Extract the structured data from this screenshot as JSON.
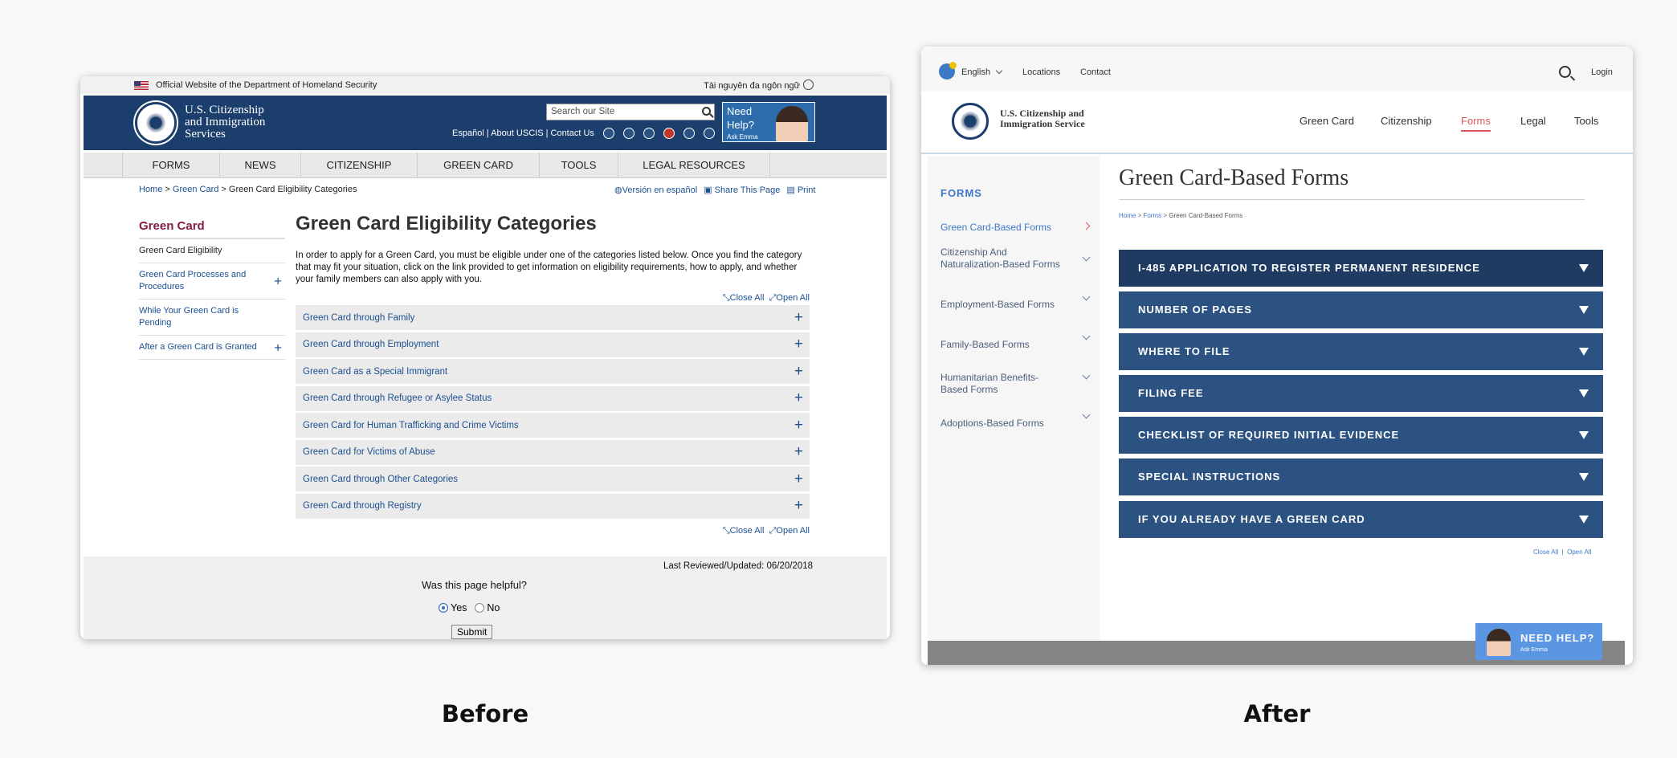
{
  "captions": {
    "before": "Before",
    "after": "After"
  },
  "before": {
    "gov_banner": "Official Website of the Department of Homeland Security",
    "language_link": "Tài nguyên đa ngôn ngữ",
    "agency_name": [
      "U.S. Citizenship",
      "and Immigration",
      "Services"
    ],
    "search_placeholder": "Search our Site",
    "header_links": "Español | About USCIS | Contact Us",
    "need_help": "Need Help?",
    "ask_emma": "Ask Emma",
    "nav": [
      "FORMS",
      "NEWS",
      "CITIZENSHIP",
      "GREEN CARD",
      "TOOLS",
      "LEGAL RESOURCES"
    ],
    "breadcrumb": {
      "home": "Home",
      "green_card": "Green Card",
      "current": "Green Card Eligibility Categories",
      "sep": " > "
    },
    "utility": {
      "spanish": "Versión en español",
      "share": "Share This Page",
      "print": "Print"
    },
    "sidebar": {
      "title": "Green Card",
      "items": [
        {
          "label": "Green Card Eligibility",
          "expand": ""
        },
        {
          "label": "Green Card Processes and Procedures",
          "expand": "+"
        },
        {
          "label": "While Your Green Card is Pending",
          "expand": ""
        },
        {
          "label": "After a Green Card is Granted",
          "expand": "+"
        }
      ]
    },
    "page_title": "Green Card Eligibility Categories",
    "intro": "In order to apply for a Green Card, you must be eligible under one of the categories listed below. Once you find the category that may fit your situation, click on the link provided to get information on eligibility requirements, how to apply, and whether your family members can also apply with you.",
    "close_all": "Close All",
    "open_all": "Open All",
    "accordion": [
      "Green Card through Family",
      "Green Card through Employment",
      "Green Card as a Special Immigrant",
      "Green Card through Refugee or Asylee Status",
      "Green Card for Human Trafficking and Crime Victims",
      "Green Card for Victims of Abuse",
      "Green Card through Other Categories",
      "Green Card through Registry"
    ],
    "expand_symbol": "+",
    "last_reviewed": "Last Reviewed/Updated: 06/20/2018",
    "helpful_question": "Was this page helpful?",
    "yes": "Yes",
    "no": "No",
    "submit": "Submit"
  },
  "after": {
    "language": "English",
    "locations": "Locations",
    "contact": "Contact",
    "login": "Login",
    "agency_name": [
      "U.S. Citizenship and",
      "Immigration Service"
    ],
    "nav": [
      "Green Card",
      "Citizenship",
      "Forms",
      "Legal",
      "Tools"
    ],
    "nav_active": "Forms",
    "sidebar_title": "FORMS",
    "sidebar": [
      "Green Card-Based Forms",
      "Citizenship And Naturalization-Based Forms",
      "Employment-Based Forms",
      "Family-Based Forms",
      "Humanitarian Benefits-Based Forms",
      "Adoptions-Based Forms"
    ],
    "page_title": "Green Card-Based Forms",
    "breadcrumb": {
      "home": "Home",
      "forms": "Forms",
      "current": "Green Card-Based Forms",
      "sep": " > "
    },
    "accordion": [
      "I-485 APPLICATION TO REGISTER PERMANENT RESIDENCE",
      "NUMBER OF PAGES",
      "WHERE TO FILE",
      "FILING FEE",
      "CHECKLIST OF REQUIRED INITIAL EVIDENCE",
      "SPECIAL INSTRUCTIONS",
      "IF YOU ALREADY HAVE A GREEN CARD"
    ],
    "close_all": "Close All",
    "open_all": "Open All",
    "need_help": "NEED HELP?",
    "ask_emma": "Ask Emma"
  },
  "colors": {
    "uscis_navy": "#1b3e6c",
    "link_blue": "#1b4f8f",
    "accent_red": "#e1575e",
    "after_blue": "#3d78c6"
  }
}
